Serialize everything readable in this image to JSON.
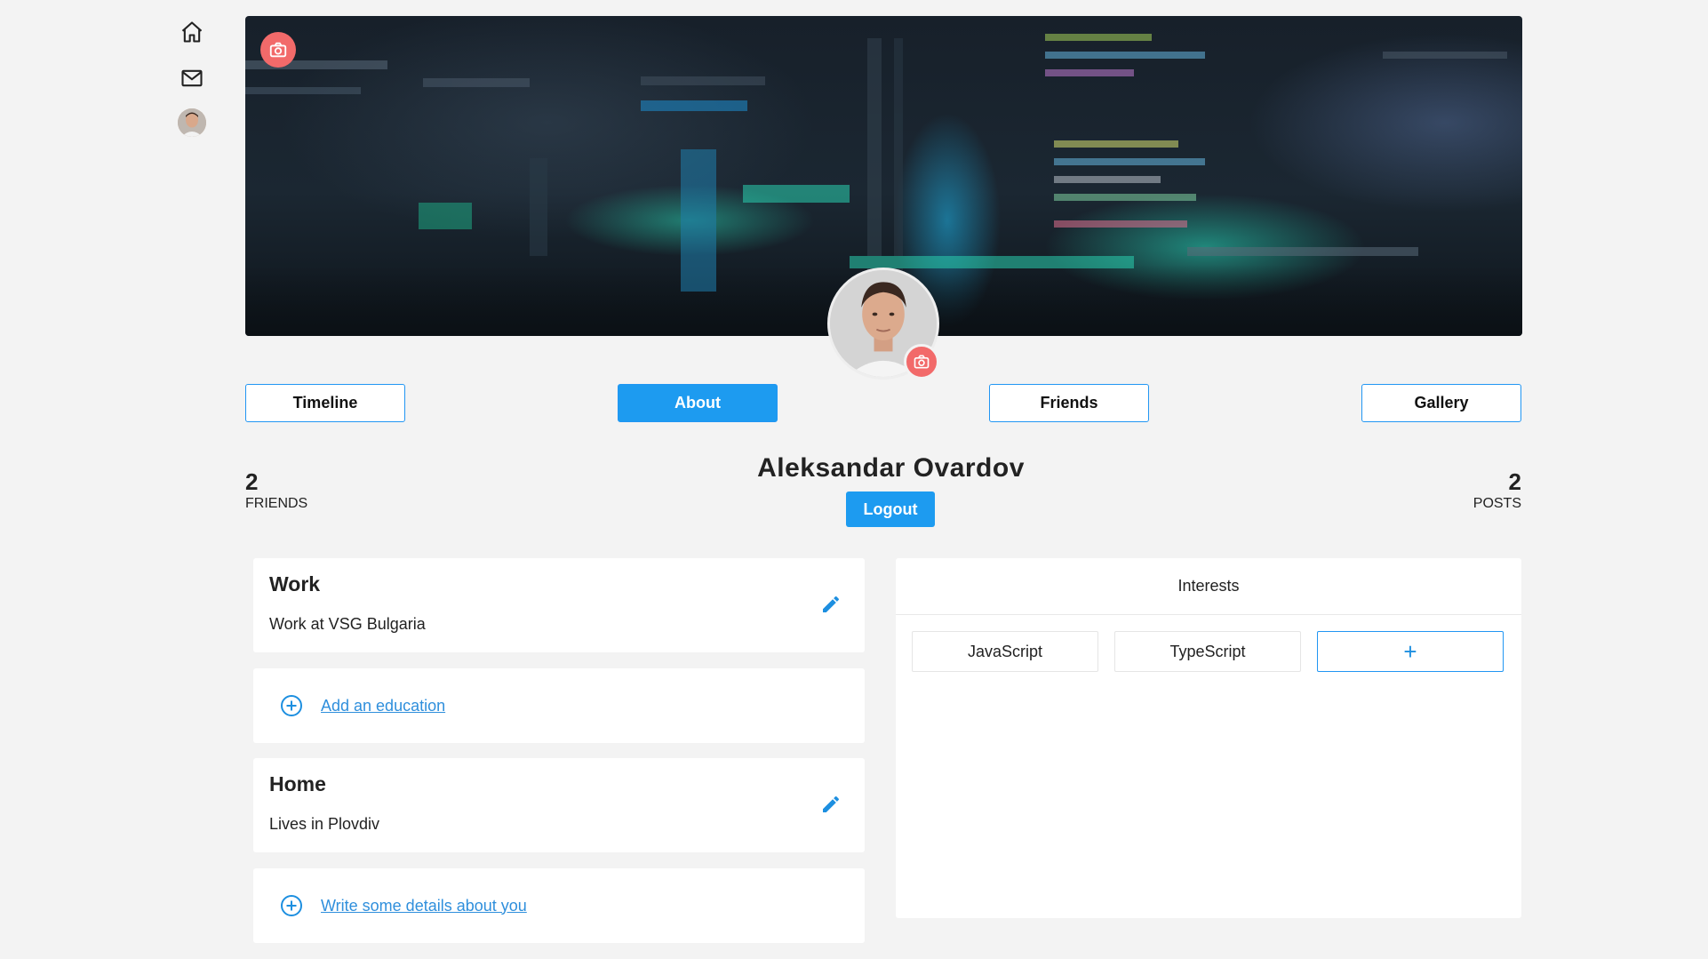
{
  "nav": {
    "home_icon": "home-icon",
    "mail_icon": "mail-icon",
    "avatar": "user-avatar"
  },
  "profile": {
    "name": "Aleksandar Ovardov",
    "logout_label": "Logout",
    "friends_count": "2",
    "friends_label": "FRIENDS",
    "posts_count": "2",
    "posts_label": "POSTS"
  },
  "tabs": [
    {
      "label": "Timeline",
      "active": false
    },
    {
      "label": "About",
      "active": true
    },
    {
      "label": "Friends",
      "active": false
    },
    {
      "label": "Gallery",
      "active": false
    }
  ],
  "about": {
    "work": {
      "title": "Work",
      "text": "Work at VSG Bulgaria"
    },
    "education": {
      "link": "Add an education"
    },
    "home": {
      "title": "Home",
      "text": "Lives in Plovdiv"
    },
    "details": {
      "link": "Write some details about you"
    }
  },
  "interests": {
    "title": "Interests",
    "items": [
      "JavaScript",
      "TypeScript"
    ],
    "add_label": "+"
  },
  "colors": {
    "accent": "#1d9bf0",
    "camera": "#f26a6a",
    "link": "#2f8fdc"
  }
}
